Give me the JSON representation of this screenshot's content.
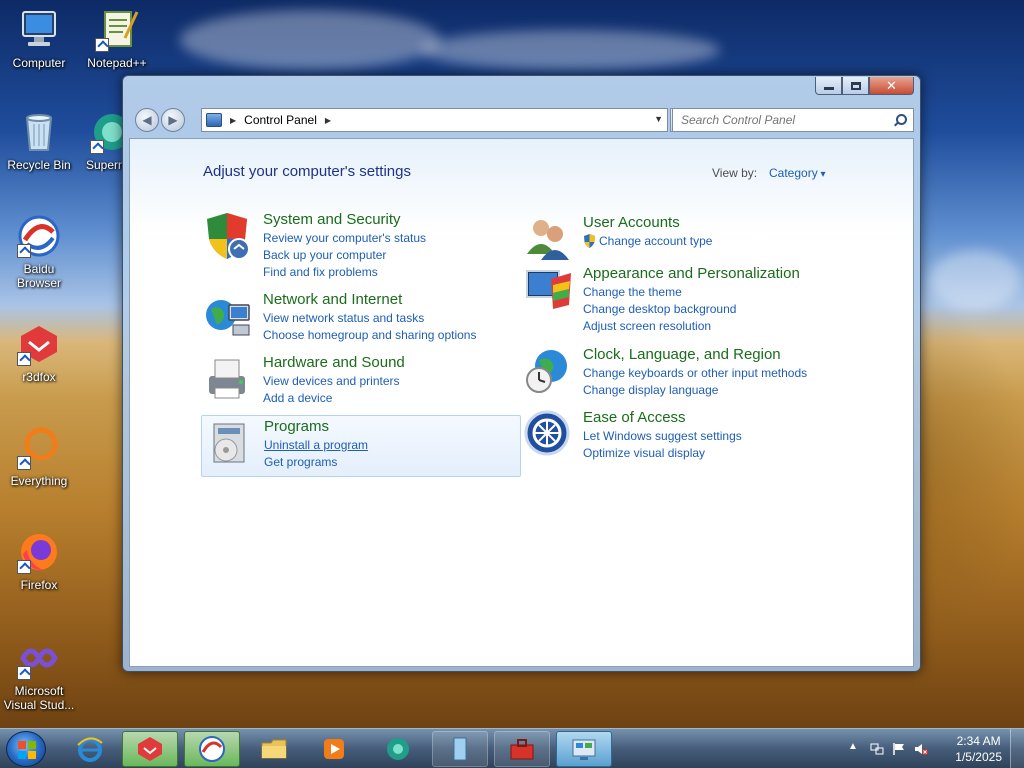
{
  "desktop": {
    "icons": [
      {
        "label": "Computer"
      },
      {
        "label": "Notepad++"
      },
      {
        "label": "Recycle Bin"
      },
      {
        "label": "Superm"
      },
      {
        "label": "Baidu Browser"
      },
      {
        "label": "r3dfox"
      },
      {
        "label": "Everything"
      },
      {
        "label": "Firefox"
      },
      {
        "label": "Microsoft Visual Stud..."
      }
    ]
  },
  "window": {
    "address": {
      "crumb": "Control Panel"
    },
    "search": {
      "placeholder": "Search Control Panel"
    },
    "heading": "Adjust your computer's settings",
    "view_by": {
      "label": "View by:",
      "value": "Category"
    },
    "categories": [
      {
        "title": "System and Security",
        "links": [
          "Review your computer's status",
          "Back up your computer",
          "Find and fix problems"
        ]
      },
      {
        "title": "Network and Internet",
        "links": [
          "View network status and tasks",
          "Choose homegroup and sharing options"
        ]
      },
      {
        "title": "Hardware and Sound",
        "links": [
          "View devices and printers",
          "Add a device"
        ]
      },
      {
        "title": "Programs",
        "links": [
          "Uninstall a program",
          "Get programs"
        ]
      },
      {
        "title": "User Accounts",
        "links": [
          "Change account type"
        ]
      },
      {
        "title": "Appearance and Personalization",
        "links": [
          "Change the theme",
          "Change desktop background",
          "Adjust screen resolution"
        ]
      },
      {
        "title": "Clock, Language, and Region",
        "links": [
          "Change keyboards or other input methods",
          "Change display language"
        ]
      },
      {
        "title": "Ease of Access",
        "links": [
          "Let Windows suggest settings",
          "Optimize visual display"
        ]
      }
    ]
  },
  "taskbar": {
    "clock": {
      "time": "2:34 AM",
      "date": "1/5/2025"
    }
  },
  "colors": {
    "category_title": "#1b6c1b",
    "link": "#1e5eb6",
    "heading": "#1e3287"
  }
}
